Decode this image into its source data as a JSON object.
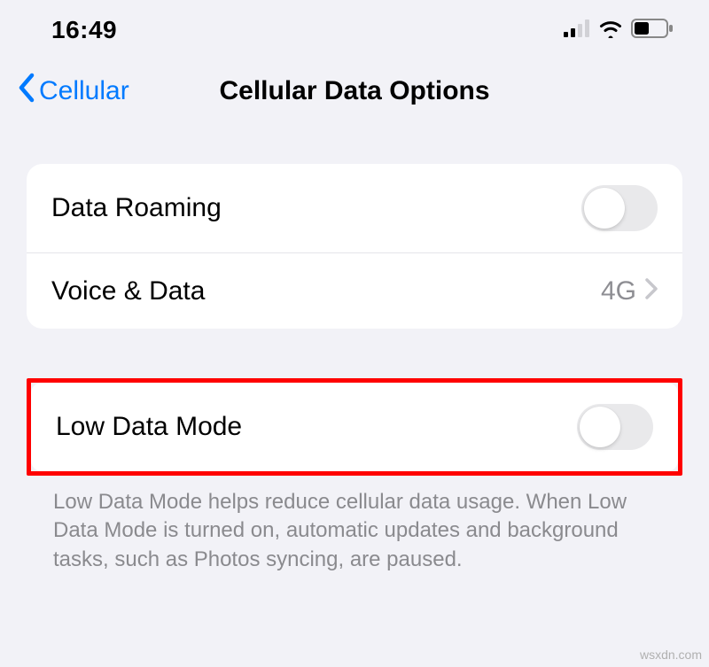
{
  "status": {
    "time": "16:49"
  },
  "nav": {
    "back_label": "Cellular",
    "title": "Cellular Data Options"
  },
  "group1": {
    "data_roaming": {
      "label": "Data Roaming",
      "on": false
    },
    "voice_data": {
      "label": "Voice & Data",
      "value": "4G"
    }
  },
  "group2": {
    "low_data_mode": {
      "label": "Low Data Mode",
      "on": false
    },
    "footer": "Low Data Mode helps reduce cellular data usage. When Low Data Mode is turned on, automatic updates and background tasks, such as Photos syncing, are paused."
  },
  "watermark": "wsxdn.com"
}
